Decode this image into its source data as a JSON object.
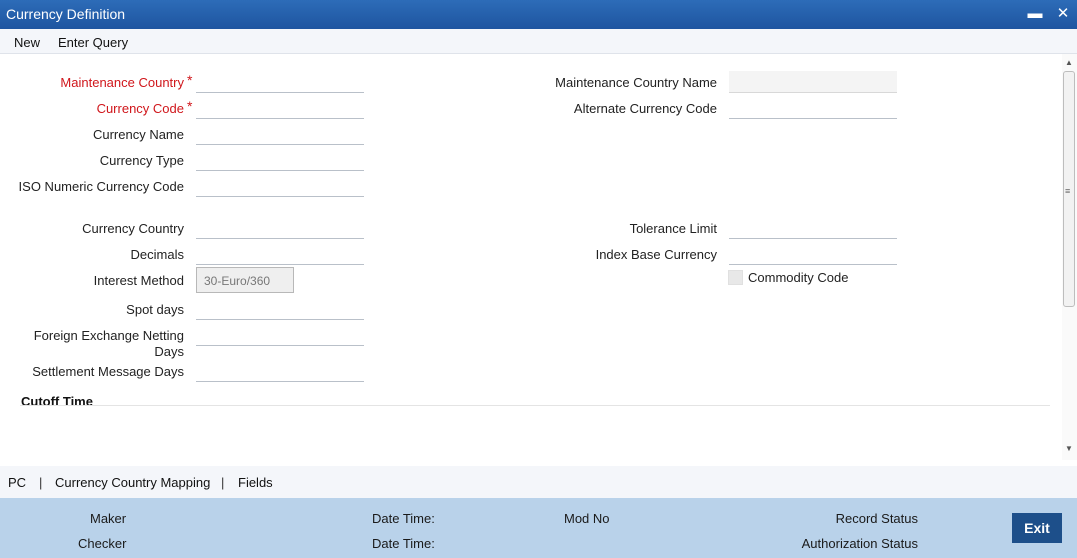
{
  "window": {
    "title": "Currency Definition",
    "minimize_glyph": "▬",
    "close_glyph": "✕"
  },
  "toolbar": {
    "new_label": "New",
    "enter_query_label": "Enter Query"
  },
  "form": {
    "maintenance_country": {
      "label": "Maintenance Country",
      "required": "*",
      "value": ""
    },
    "currency_code": {
      "label": "Currency Code",
      "required": "*",
      "value": ""
    },
    "currency_name": {
      "label": "Currency Name",
      "value": ""
    },
    "currency_type": {
      "label": "Currency Type",
      "value": ""
    },
    "iso_numeric_code": {
      "label": "ISO Numeric Currency Code",
      "value": ""
    },
    "currency_country": {
      "label": "Currency Country",
      "value": ""
    },
    "decimals": {
      "label": "Decimals",
      "value": ""
    },
    "interest_method": {
      "label": "Interest Method",
      "value": "30-Euro/360"
    },
    "spot_days": {
      "label": "Spot days",
      "value": ""
    },
    "fx_netting_days": {
      "label_line1": "Foreign Exchange Netting",
      "label_line2": "Days",
      "value": ""
    },
    "settlement_message_days": {
      "label": "Settlement Message Days",
      "value": ""
    },
    "maintenance_country_name": {
      "label": "Maintenance Country Name",
      "value": ""
    },
    "alternate_currency_code": {
      "label": "Alternate Currency Code",
      "value": ""
    },
    "tolerance_limit": {
      "label": "Tolerance Limit",
      "value": ""
    },
    "index_base_currency": {
      "label": "Index Base Currency",
      "value": ""
    },
    "commodity_code": {
      "label": "Commodity Code",
      "checked": false
    },
    "cutoff_section_title": "Cutoff Time"
  },
  "scrollbar": {
    "up_glyph": "▲",
    "down_glyph": "▼",
    "grip_glyph": "≡"
  },
  "subnav": {
    "items": [
      "PC",
      "Currency Country Mapping",
      "Fields"
    ],
    "separator": "|"
  },
  "statusbar": {
    "maker": "Maker",
    "checker": "Checker",
    "date_time_1": "Date Time:",
    "date_time_2": "Date Time:",
    "mod_no": "Mod No",
    "record_status": "Record Status",
    "authorization_status": "Authorization Status",
    "exit_label": "Exit"
  },
  "colors": {
    "titlebar": "#1e55a0",
    "required_label": "#d0161b",
    "statusbar": "#b9d2ea",
    "exit_button": "#1d4f8a"
  }
}
